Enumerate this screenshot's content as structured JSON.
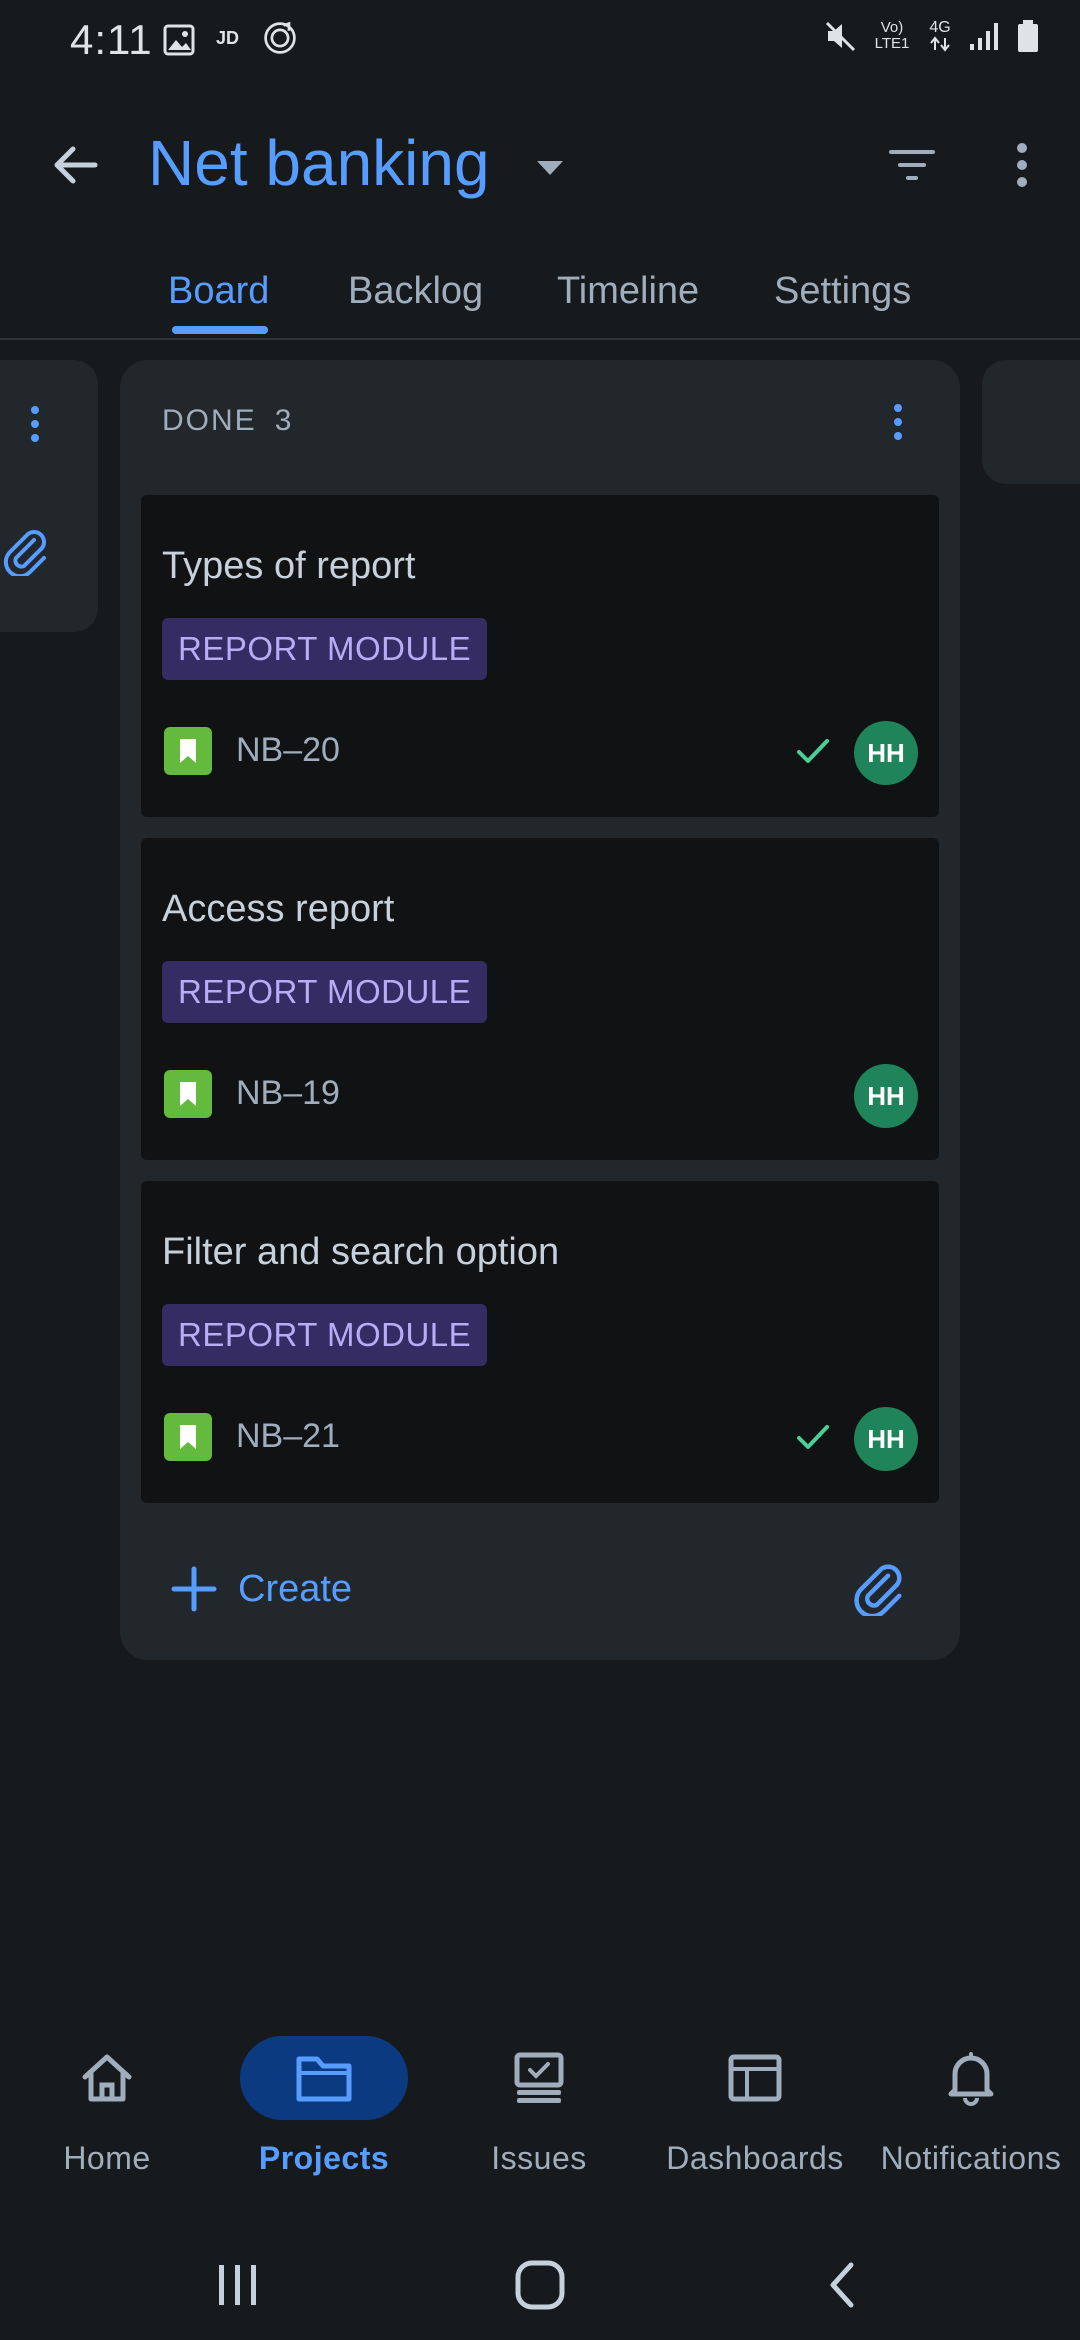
{
  "status_bar": {
    "time": "4:11",
    "network_label": "Vo) LTE1",
    "network_type": "4G"
  },
  "header": {
    "title": "Net banking"
  },
  "tabs": [
    {
      "label": "Board",
      "active": true
    },
    {
      "label": "Backlog",
      "active": false
    },
    {
      "label": "Timeline",
      "active": false
    },
    {
      "label": "Settings",
      "active": false
    }
  ],
  "column": {
    "name": "DONE",
    "count": "3",
    "create_label": "Create"
  },
  "cards": [
    {
      "title": "Types of report",
      "tag": "REPORT MODULE",
      "key": "NB–20",
      "done": true,
      "assignee": "HH"
    },
    {
      "title": "Access report",
      "tag": "REPORT MODULE",
      "key": "NB–19",
      "done": false,
      "assignee": "HH"
    },
    {
      "title": "Filter and search option",
      "tag": "REPORT MODULE",
      "key": "NB–21",
      "done": true,
      "assignee": "HH"
    }
  ],
  "bottom_nav": [
    {
      "label": "Home",
      "icon": "home-icon",
      "active": false
    },
    {
      "label": "Projects",
      "icon": "folder-icon",
      "active": true
    },
    {
      "label": "Issues",
      "icon": "issues-icon",
      "active": false
    },
    {
      "label": "Dashboards",
      "icon": "dashboard-icon",
      "active": false
    },
    {
      "label": "Notifications",
      "icon": "bell-icon",
      "active": false
    }
  ],
  "colors": {
    "accent": "#579dff",
    "tag_bg": "#352c63",
    "tag_text": "#b8acf6",
    "story_icon": "#63ba3c",
    "avatar": "#1f845a",
    "done_check": "#4bce97"
  }
}
